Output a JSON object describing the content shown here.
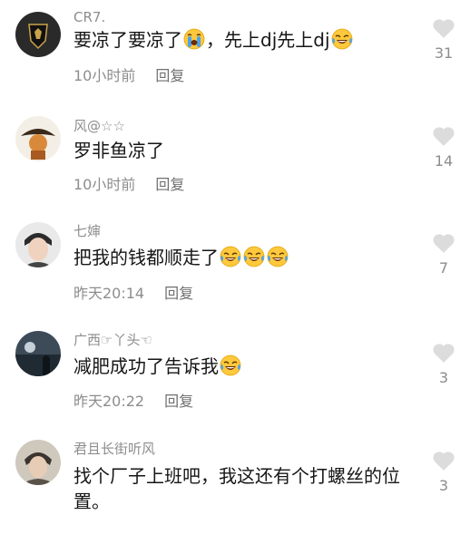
{
  "comments": [
    {
      "username": "CR7.",
      "text_parts": [
        "要凉了要凉了",
        "，先上dj先上dj"
      ],
      "emojis": [
        "crying-face",
        "rofl-face"
      ],
      "time": "10小时前",
      "reply": "回复",
      "likes": "31"
    },
    {
      "username": "风@☆☆",
      "text": "罗非鱼凉了",
      "time": "10小时前",
      "reply": "回复",
      "likes": "14"
    },
    {
      "username": "七婶",
      "text": "把我的钱都顺走了",
      "emojis": [
        "rofl-face",
        "rofl-face",
        "rofl-face"
      ],
      "time": "昨天20:14",
      "reply": "回复",
      "likes": "7"
    },
    {
      "username": "广西☞丫头☜",
      "text": "减肥成功了告诉我",
      "emojis": [
        "rofl-face"
      ],
      "time": "昨天20:22",
      "reply": "回复",
      "likes": "3"
    },
    {
      "username": "君且长街听风",
      "text": "找个厂子上班吧，我这还有个打螺丝的位置。",
      "likes": "3"
    }
  ],
  "colors": {
    "text": "#161616",
    "secondary": "#8d8d8d",
    "heart": "#dcdcdc",
    "emoji_yellow": "#ffc83d",
    "tear_blue": "#4aa3f0"
  }
}
